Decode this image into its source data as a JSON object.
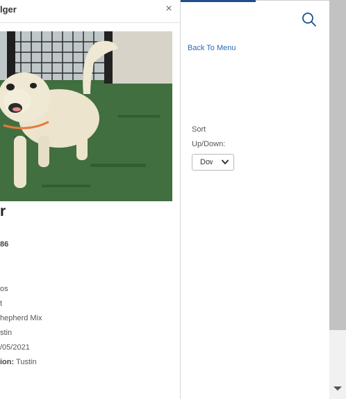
{
  "modal": {
    "title": "lger",
    "close_label": "×",
    "photo_alt": "dog",
    "pet_name": "r",
    "pet_id": "86",
    "details": [
      "os",
      "t",
      "hepherd Mix",
      "stin",
      "/05/2021"
    ],
    "location_label": "ion:",
    "location_value": "Tustin"
  },
  "nav": {
    "back_label": "Back To Menu",
    "search_icon": "search-icon"
  },
  "sort": {
    "label": "Sort Up/Down:",
    "selected": "Down"
  },
  "colors": {
    "accent": "#1e4f8c",
    "link": "#2a6bb8",
    "scroll_thumb": "#c2c2c2"
  }
}
